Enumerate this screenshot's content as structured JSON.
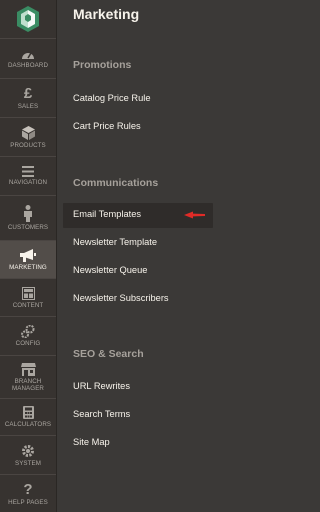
{
  "sidebar": {
    "items": [
      {
        "label": "DASHBOARD",
        "icon": "speedometer-icon"
      },
      {
        "label": "SALES",
        "icon": "pound-icon"
      },
      {
        "label": "PRODUCTS",
        "icon": "cube-icon"
      },
      {
        "label": "NAVIGATION",
        "icon": "menu-icon"
      },
      {
        "label": "CUSTOMERS",
        "icon": "person-icon"
      },
      {
        "label": "MARKETING",
        "icon": "megaphone-icon"
      },
      {
        "label": "CONTENT",
        "icon": "layout-icon"
      },
      {
        "label": "CONFIG",
        "icon": "gears-icon"
      },
      {
        "label": "BRANCH MANAGER",
        "icon": "store-icon"
      },
      {
        "label": "CALCULATORS",
        "icon": "calculator-icon"
      },
      {
        "label": "SYSTEM",
        "icon": "gear-icon"
      },
      {
        "label": "HELP PAGES",
        "icon": "question-icon"
      }
    ],
    "active": "MARKETING"
  },
  "panel": {
    "title": "Marketing",
    "sections": [
      {
        "title": "Promotions",
        "items": [
          "Catalog Price Rule",
          "Cart Price Rules"
        ]
      },
      {
        "title": "Communications",
        "items": [
          "Email Templates",
          "Newsletter Template",
          "Newsletter Queue",
          "Newsletter Subscribers"
        ]
      },
      {
        "title": "SEO & Search",
        "items": [
          "URL Rewrites",
          "Search Terms",
          "Site Map"
        ]
      }
    ],
    "highlighted": "Email Templates"
  },
  "colors": {
    "accent_arrow": "#e02b27",
    "active_bg": "#524d49",
    "text": "#f7f3eb"
  }
}
